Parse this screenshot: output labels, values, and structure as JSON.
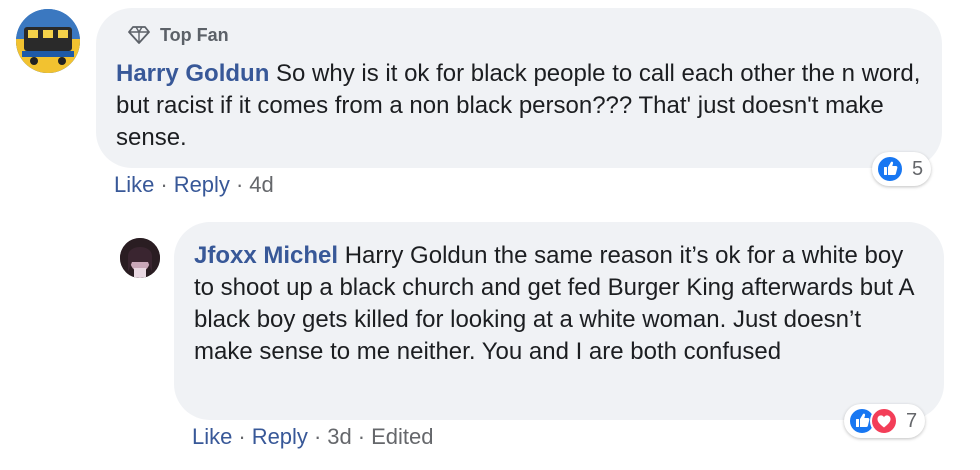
{
  "colors": {
    "author_link": "#385898",
    "bubble_bg": "#f0f2f5",
    "text": "#1c1e21",
    "meta": "#65676b",
    "like_blue": "#1877f2",
    "love_red": "#f33e58"
  },
  "comments": [
    {
      "badge": {
        "icon": "diamond-icon",
        "label": "Top Fan"
      },
      "author": "Harry Goldun",
      "text": "So why is it ok for black people to call each other the n word, but racist if it comes from a non black person??? That' just doesn't make sense.",
      "actions": {
        "like": "Like",
        "reply": "Reply",
        "time": "4d"
      },
      "reactions": {
        "icons": [
          "like-icon"
        ],
        "count": "5"
      }
    },
    {
      "author": "Jfoxx Michel",
      "text": "Harry Goldun the same reason it’s ok for a white boy to shoot up a black church and get fed Burger King afterwards but A black boy gets killed for looking at a white woman. Just doesn’t make sense to me neither. You and I are both confused",
      "actions": {
        "like": "Like",
        "reply": "Reply",
        "time": "3d",
        "edited": "Edited"
      },
      "reactions": {
        "icons": [
          "like-icon",
          "love-icon"
        ],
        "count": "7"
      }
    }
  ]
}
